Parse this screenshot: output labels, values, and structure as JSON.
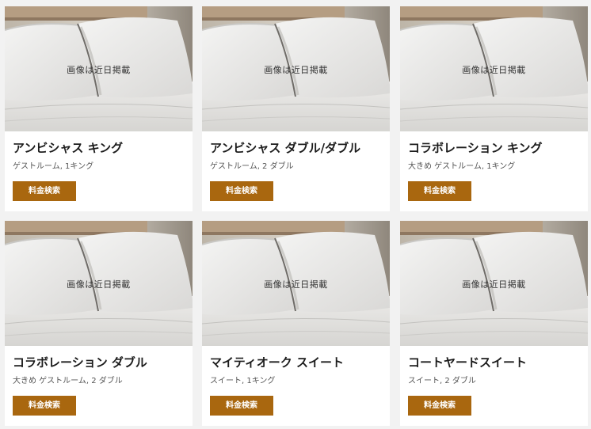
{
  "placeholder_text": "画像は近日掲載",
  "button_label": "料金検索",
  "accent_color": "#a9670f",
  "cards": [
    {
      "title": "アンビシャス キング",
      "subtitle": "ゲストルーム, 1キング"
    },
    {
      "title": "アンビシャス ダブル/ダブル",
      "subtitle": "ゲストルーム, 2 ダブル"
    },
    {
      "title": "コラボレーション キング",
      "subtitle": "大きめ ゲストルーム, 1キング"
    },
    {
      "title": "コラボレーション ダブル",
      "subtitle": "大きめ ゲストルーム, 2 ダブル"
    },
    {
      "title": "マイティオーク スイート",
      "subtitle": "スイート, 1キング"
    },
    {
      "title": "コートヤードスイート",
      "subtitle": "スイート, 2 ダブル"
    }
  ]
}
